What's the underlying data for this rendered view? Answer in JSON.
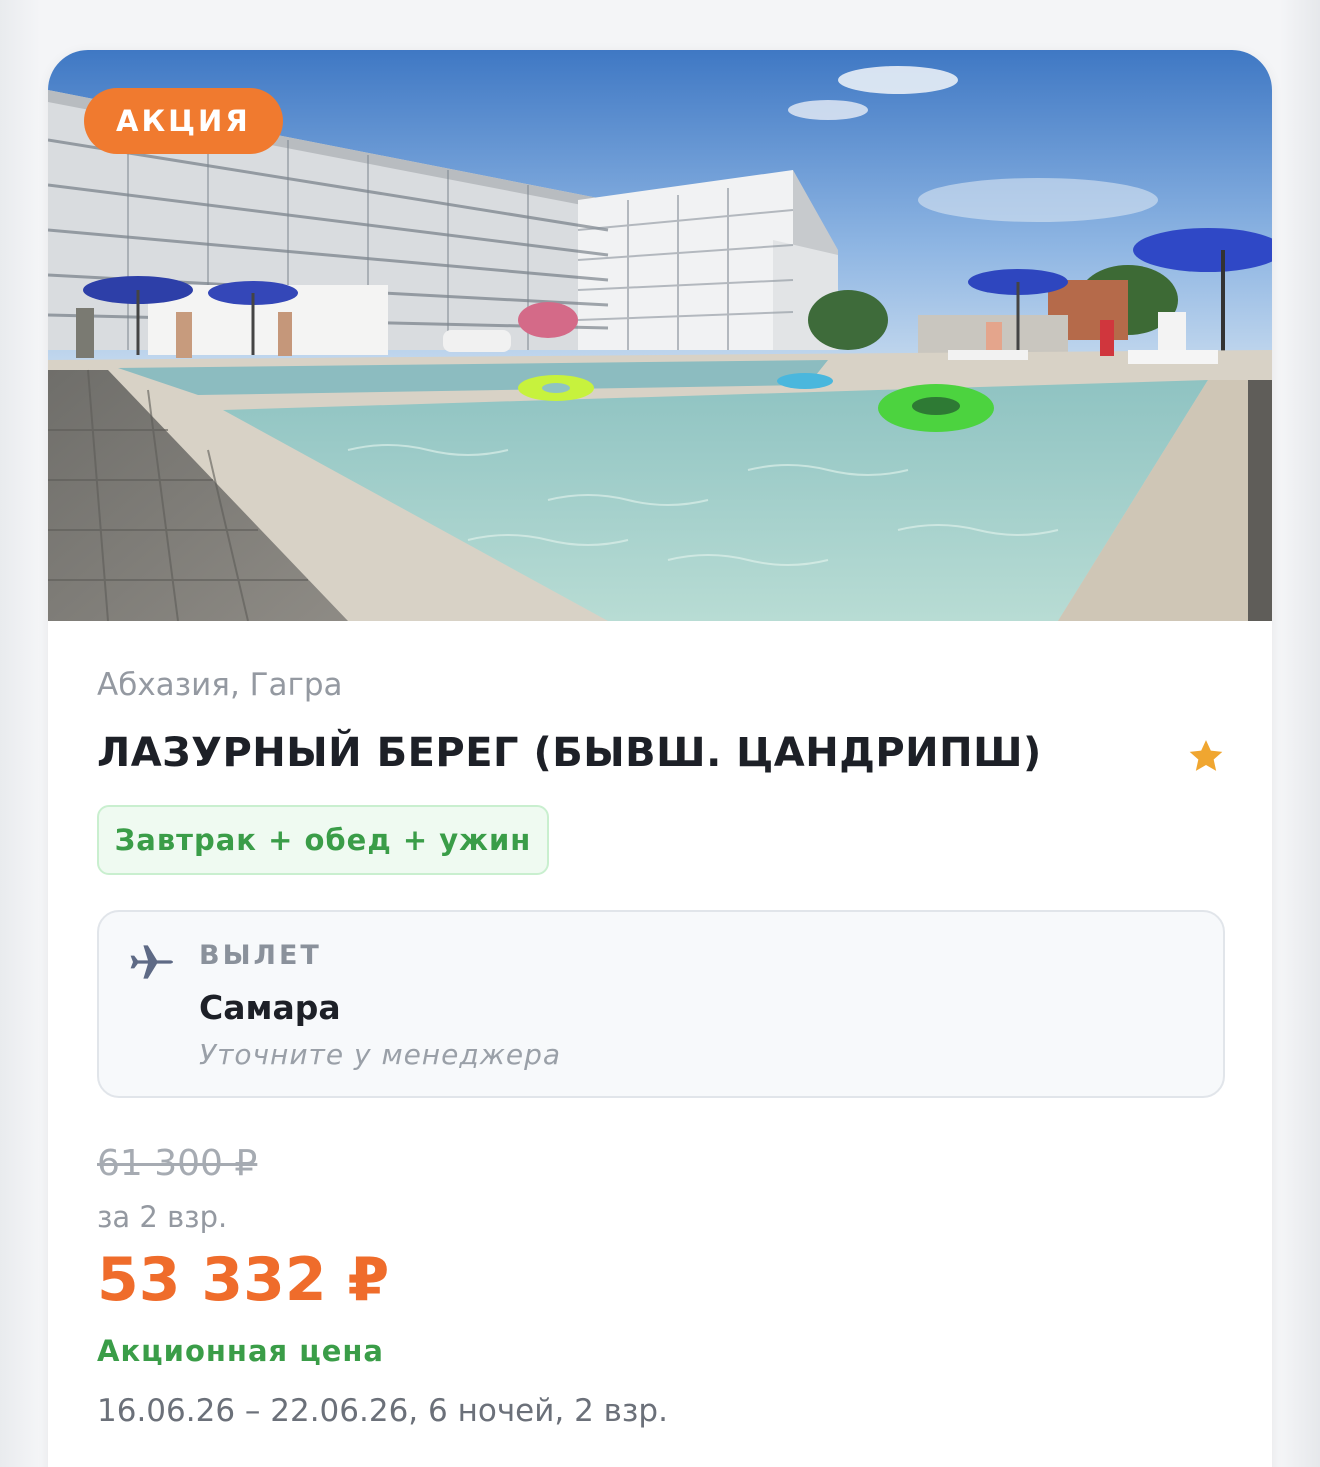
{
  "tour": {
    "badge": "АКЦИЯ",
    "location": "Абхазия, Гагра",
    "hotel_name": "ЛАЗУРНЫЙ БЕРЕГ (БЫВШ. ЦАНДРИПШ)",
    "stars": 1,
    "meal": "Завтрак + обед + ужин",
    "photo_alt": "hotel-pool-photo"
  },
  "departure": {
    "label": "ВЫЛЕТ",
    "city": "Самара",
    "note": "Уточните у менеджера",
    "icon": "plane-icon"
  },
  "pricing": {
    "old_price": "61 300 ₽",
    "per_people": "за 2 взр.",
    "price": "53 332 ₽",
    "promo_label": "Акционная цена",
    "dates": "16.06.26 – 22.06.26, 6 ночей, 2 взр."
  },
  "colors": {
    "accent": "#ef6c2b",
    "badge": "#f07a2f",
    "green": "#3a9d48",
    "star": "#f0a630"
  }
}
